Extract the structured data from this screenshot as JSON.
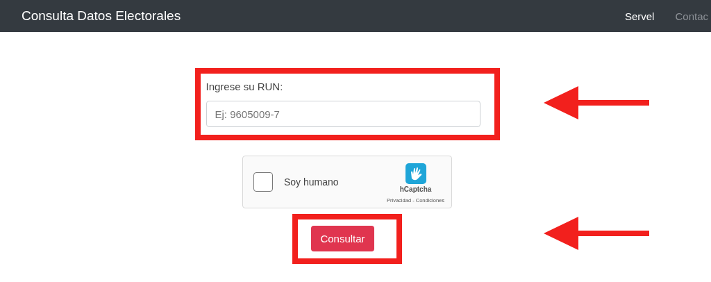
{
  "navbar": {
    "title": "Consulta Datos Electorales",
    "links": [
      {
        "label": "Servel",
        "selected": true
      },
      {
        "label": "Contac",
        "selected": false
      }
    ]
  },
  "run_field": {
    "label": "Ingrese su RUN:",
    "placeholder": "Ej: 9605009-7"
  },
  "captcha": {
    "label": "Soy humano",
    "checked": false,
    "brand": "hCaptcha",
    "links": "Privacidad - Condiciones"
  },
  "submit_button": {
    "label": "Consultar"
  }
}
